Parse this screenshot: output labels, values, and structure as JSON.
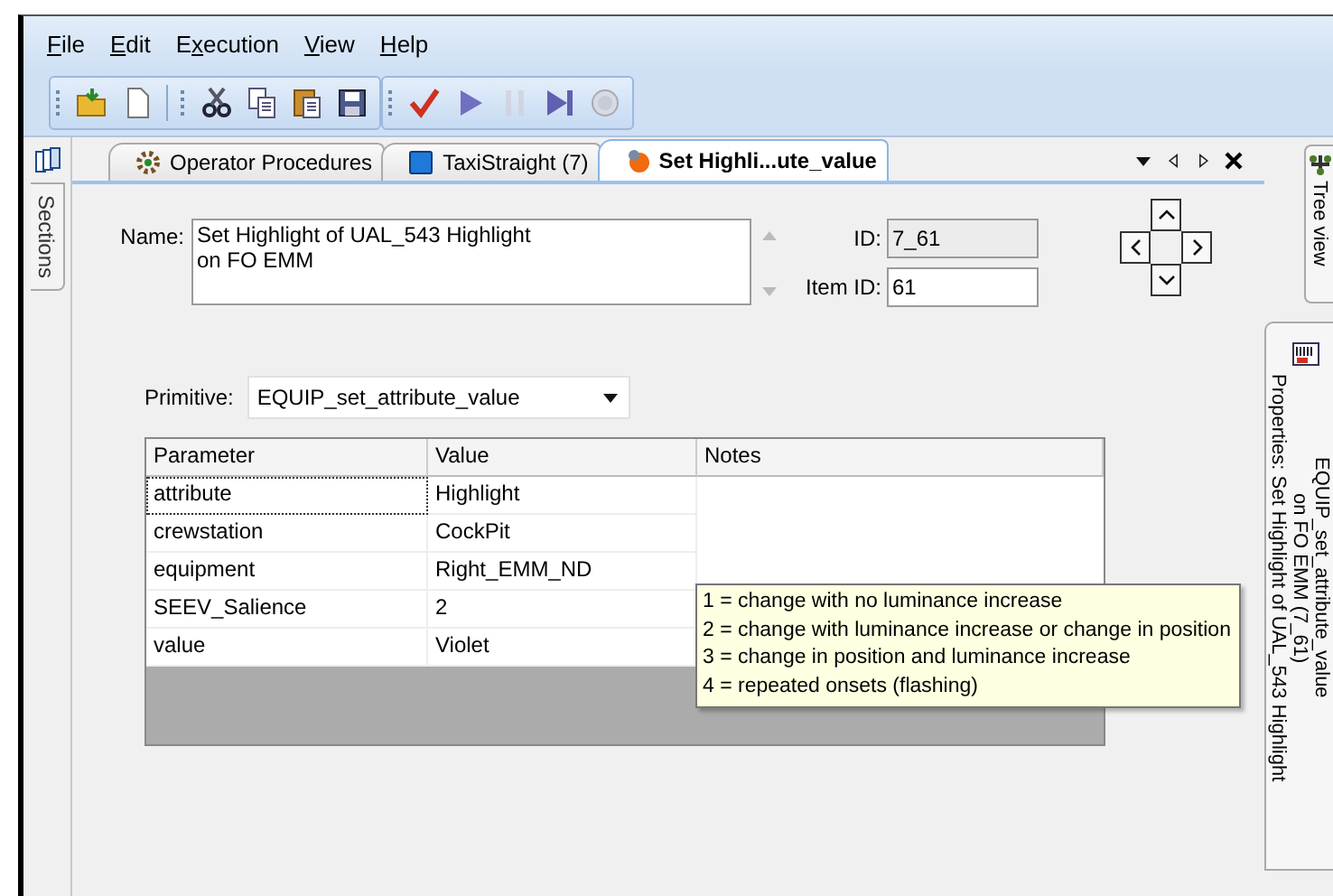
{
  "menu": [
    {
      "key": "F",
      "post": "ile"
    },
    {
      "key": "E",
      "post": "dit"
    },
    {
      "pre": "E",
      "key": "x",
      "post": "ecution"
    },
    {
      "key": "V",
      "post": "iew"
    },
    {
      "key": "H",
      "post": "elp"
    }
  ],
  "toolbars": [
    {
      "sections": [
        {
          "buttons": [
            {
              "kind": "open",
              "disabled": false
            },
            {
              "kind": "new",
              "disabled": false
            }
          ]
        },
        {
          "buttons": [
            {
              "kind": "cut",
              "disabled": false
            },
            {
              "kind": "copy",
              "disabled": false
            },
            {
              "kind": "paste",
              "disabled": false
            },
            {
              "kind": "save",
              "disabled": false
            }
          ]
        }
      ]
    },
    {
      "sections": [
        {
          "buttons": [
            {
              "kind": "check",
              "disabled": false
            },
            {
              "kind": "play",
              "disabled": false
            },
            {
              "kind": "pause",
              "disabled": true
            },
            {
              "kind": "step",
              "disabled": false
            },
            {
              "kind": "stop",
              "disabled": true
            }
          ]
        }
      ]
    }
  ],
  "left_panel": {
    "tab": "Sections"
  },
  "tabs": [
    {
      "label": "Operator Procedures",
      "kind": "procedures",
      "selected": false
    },
    {
      "label": "TaxiStraight (7)",
      "kind": "screen",
      "selected": false
    },
    {
      "label": "Set Highli...ute_value",
      "kind": "action",
      "selected": true
    }
  ],
  "form": {
    "name_label": "Name:",
    "name_value": "Set Highlight of UAL_543 Highlight\non FO EMM",
    "id_label": "ID:",
    "id_value": "7_61",
    "id_readonly": true,
    "item_id_label": "Item ID:",
    "item_id_value": "61",
    "item_id_readonly": false,
    "primitive_label": "Primitive:",
    "primitive_value": "EQUIP_set_attribute_value"
  },
  "table": {
    "columns": [
      "Parameter",
      "Value",
      "Notes"
    ],
    "rows": [
      {
        "parameter": "attribute",
        "value": "Highlight",
        "focused": true
      },
      {
        "parameter": "crewstation",
        "value": "CockPit",
        "focused": false
      },
      {
        "parameter": "equipment",
        "value": "Right_EMM_ND",
        "focused": false
      },
      {
        "parameter": "SEEV_Salience",
        "value": "2",
        "focused": false
      },
      {
        "parameter": "value",
        "value": "Violet",
        "focused": false
      }
    ]
  },
  "tooltip": [
    "1 = change with no luminance increase",
    "2 = change with luminance increase or change in position",
    "3 = change in position and luminance increase",
    "4 = repeated onsets (flashing)"
  ],
  "right_panel": {
    "tree_tab": "Tree view",
    "properties_title": "Properties: Set Highlight of UAL_543 Highlight",
    "properties_lines": [
      "on FO EMM (7_61)",
      "EQUIP_set_attribute_value"
    ]
  }
}
